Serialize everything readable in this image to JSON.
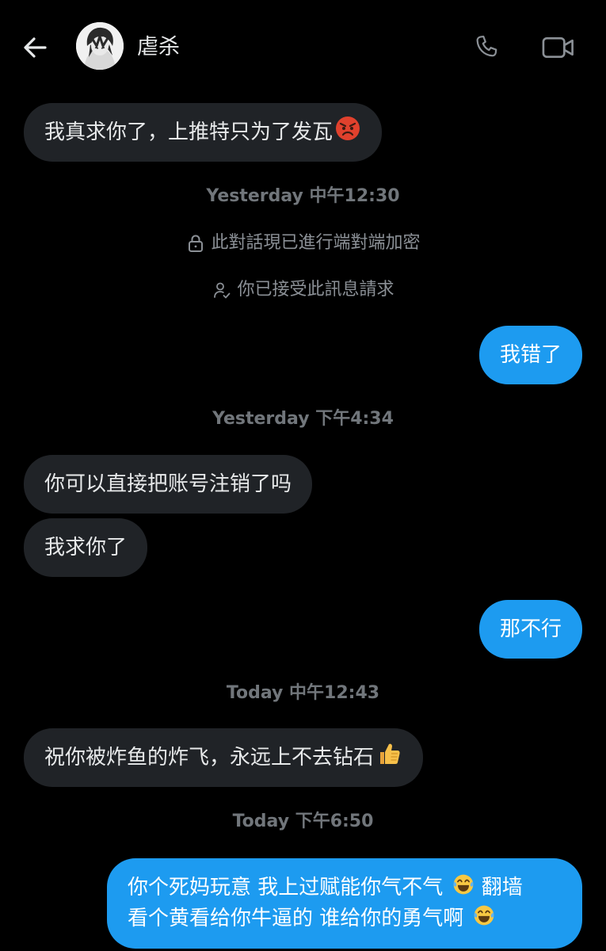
{
  "header": {
    "contact_name": "虐杀",
    "back_icon": "arrow-left-icon",
    "call_icon": "phone-icon",
    "video_icon": "video-camera-icon"
  },
  "colors": {
    "background": "#000000",
    "incoming_bubble": "#202327",
    "outgoing_bubble": "#1d9bf0",
    "muted_text": "#71767b"
  },
  "conversation": {
    "msg1": "我真求你了，上推特只为了发瓦",
    "msg1_emoji": "angry-face-emoji",
    "stamp1": "Yesterday 中午12:30",
    "system_encrypted": "此對話現已進行端對端加密",
    "system_encrypted_icon": "lock-icon",
    "system_accepted": "你已接受此訊息請求",
    "system_accepted_icon": "person-check-icon",
    "msg2": "我错了",
    "stamp2": "Yesterday 下午4:34",
    "msg3": "你可以直接把账号注销了吗",
    "msg4": "我求你了",
    "msg5": "那不行",
    "stamp3": "Today 中午12:43",
    "msg6": "祝你被炸鱼的炸飞，永远上不去钻石",
    "msg6_emoji": "thumbs-up-emoji",
    "stamp4": "Today 下午6:50",
    "msg7_line1": "你个死妈玩意 我上过赋能你气不气",
    "msg7_line1_tail": "翻墙",
    "msg7_line2": "看个黄看给你牛逼的 谁给你的勇气啊",
    "msg7_emoji": "tears-of-joy-emoji"
  }
}
